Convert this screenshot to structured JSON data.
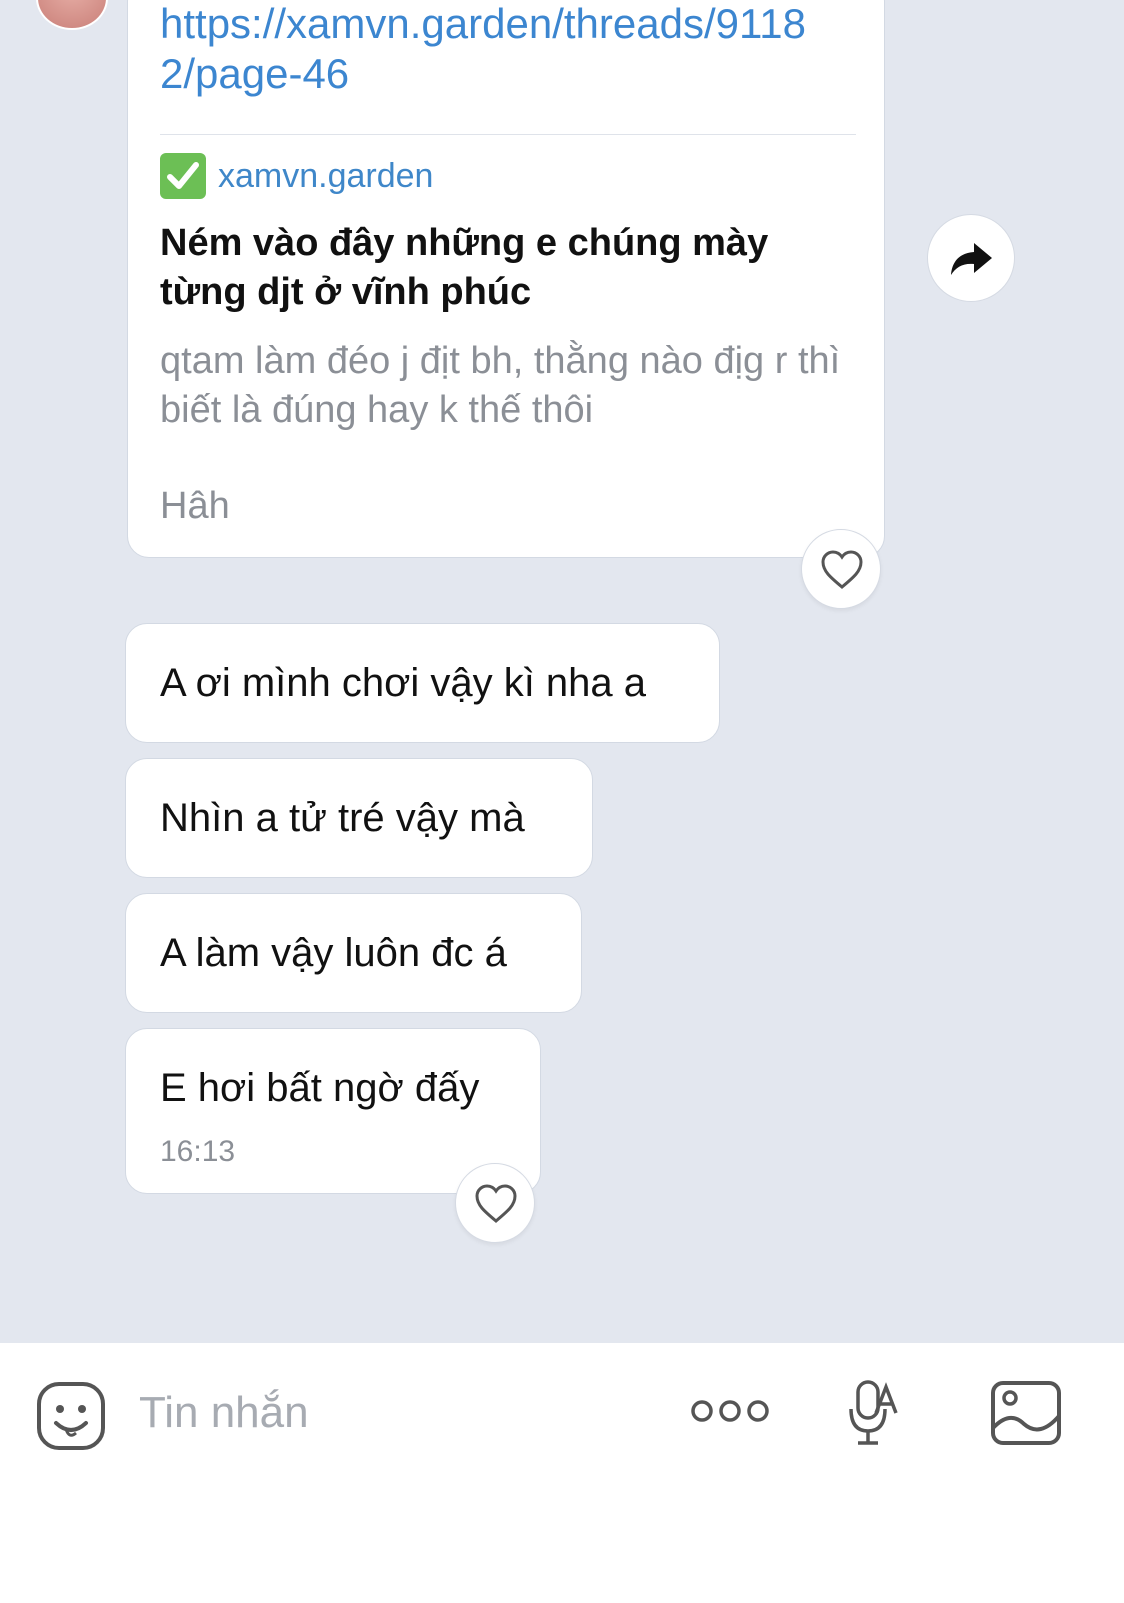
{
  "link_message": {
    "url": "https://xamvn.garden/threads/91182/page-46",
    "preview": {
      "site": "xamvn.garden",
      "title": "Ném vào đây những e chúng mày từng djt ở vĩnh phúc",
      "description": "qtam làm đéo j địt bh, thằng nào địg r thì biết là đúng hay k thế thôi",
      "extra": "Hâh"
    }
  },
  "messages": [
    {
      "text": "A ơi mình chơi vậy kì nha a"
    },
    {
      "text": "Nhìn a tử tré vậy mà"
    },
    {
      "text": "A làm vậy luôn đc á"
    },
    {
      "text": "E hơi bất ngờ đấy",
      "time": "16:13"
    }
  ],
  "composer": {
    "placeholder": "Tin nhắn"
  },
  "icons": {
    "check": "check-mark-icon",
    "share": "share-arrow-icon",
    "heart": "heart-icon",
    "emoji": "emoji-icon",
    "more": "more-dots-icon",
    "mic": "mic-icon",
    "image": "image-icon"
  },
  "colors": {
    "background": "#e3e7ef",
    "link": "#3c86d0",
    "check": "#6cbf55"
  }
}
